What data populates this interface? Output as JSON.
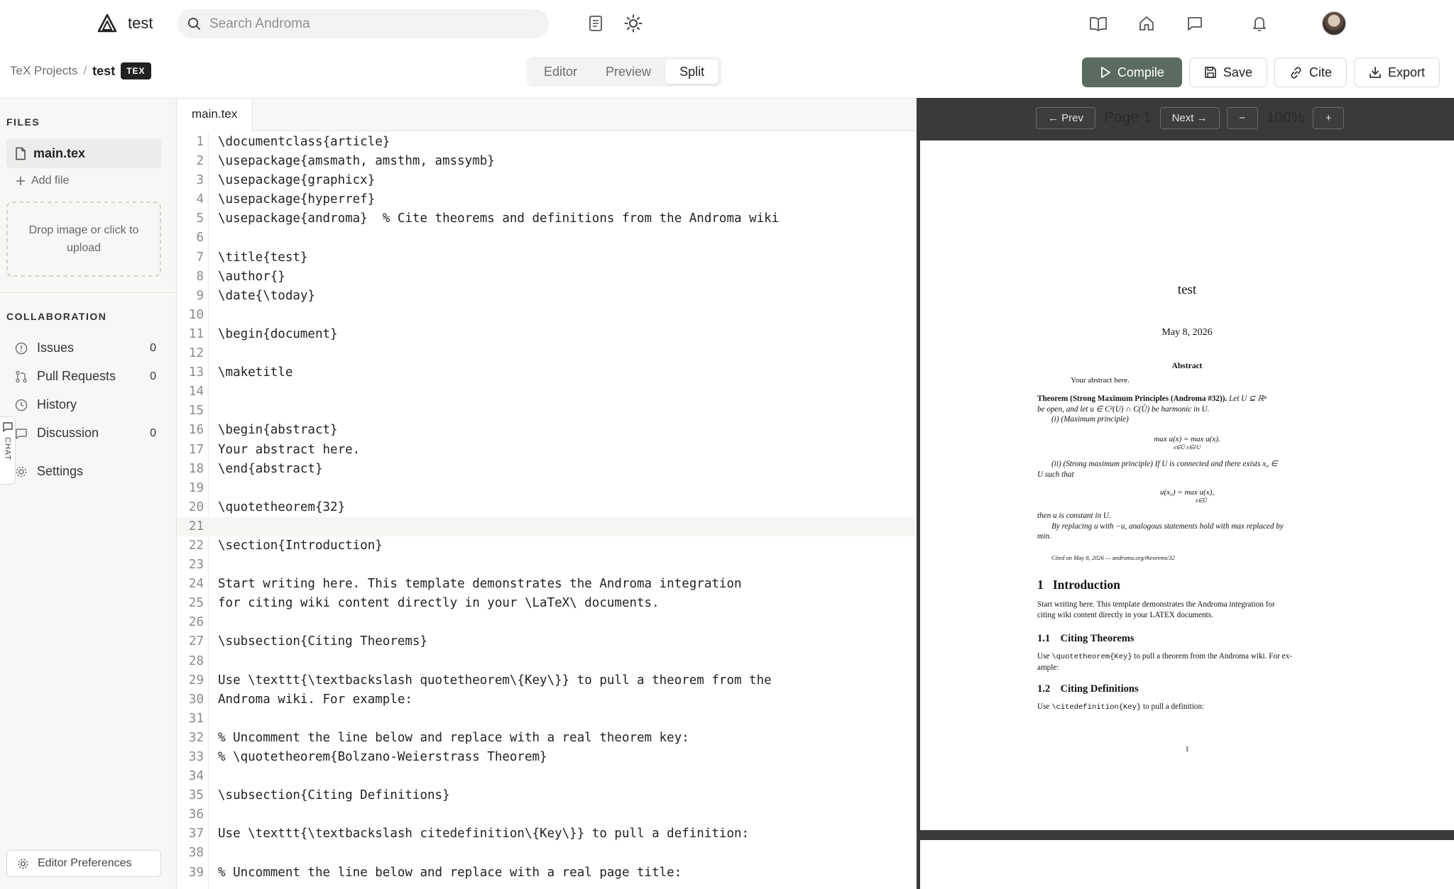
{
  "app": {
    "title": "test"
  },
  "search": {
    "placeholder": "Search Androma"
  },
  "breadcrumb": {
    "root": "TeX Projects",
    "separator": "/",
    "current": "test",
    "badge": "TEX"
  },
  "view_modes": [
    {
      "label": "Editor",
      "active": false
    },
    {
      "label": "Preview",
      "active": false
    },
    {
      "label": "Split",
      "active": true
    }
  ],
  "actions": {
    "compile": "Compile",
    "save": "Save",
    "cite": "Cite",
    "export": "Export"
  },
  "sidebar": {
    "files_title": "FILES",
    "files": [
      {
        "name": "main.tex"
      }
    ],
    "add_file": "Add file",
    "dropzone": "Drop image or click to upload",
    "collab_title": "COLLABORATION",
    "collab_items": [
      {
        "label": "Issues",
        "count": "0",
        "icon": "issue-icon"
      },
      {
        "label": "Pull Requests",
        "count": "0",
        "icon": "pull-request-icon"
      },
      {
        "label": "History",
        "count": "",
        "icon": "history-icon"
      },
      {
        "label": "Discussion",
        "count": "0",
        "icon": "discussion-icon"
      },
      {
        "label": "Settings",
        "count": "",
        "icon": "gear-icon"
      }
    ],
    "chat_tab": "CHAT",
    "editor_preferences": "Editor Preferences"
  },
  "editor": {
    "tab": "main.tex",
    "current_line": 21,
    "lines": [
      "\\documentclass{article}",
      "\\usepackage{amsmath, amsthm, amssymb}",
      "\\usepackage{graphicx}",
      "\\usepackage{hyperref}",
      "\\usepackage{androma}  % Cite theorems and definitions from the Androma wiki",
      "",
      "\\title{test}",
      "\\author{}",
      "\\date{\\today}",
      "",
      "\\begin{document}",
      "",
      "\\maketitle",
      "",
      "",
      "\\begin{abstract}",
      "Your abstract here.",
      "\\end{abstract}",
      "",
      "\\quotetheorem{32}",
      "",
      "\\section{Introduction}",
      "",
      "Start writing here. This template demonstrates the Androma integration",
      "for citing wiki content directly in your \\LaTeX\\ documents.",
      "",
      "\\subsection{Citing Theorems}",
      "",
      "Use \\texttt{\\textbackslash quotetheorem\\{Key\\}} to pull a theorem from the",
      "Androma wiki. For example:",
      "",
      "% Uncomment the line below and replace with a real theorem key:",
      "% \\quotetheorem{Bolzano-Weierstrass Theorem}",
      "",
      "\\subsection{Citing Definitions}",
      "",
      "Use \\texttt{\\textbackslash citedefinition\\{Key\\}} to pull a definition:",
      "",
      "% Uncomment the line below and replace with a real page title:"
    ]
  },
  "preview": {
    "prev": "← Prev",
    "page_label": "Page 1",
    "next": "Next →",
    "zoom_out": "−",
    "zoom": "100%",
    "zoom_in": "+",
    "doc": {
      "title": "test",
      "date": "May 8, 2026",
      "abstract_heading": "Abstract",
      "abstract": "Your abstract here.",
      "theorem_head": "Theorem (Strong Maximum Principles (Androma #32)).",
      "theorem_line1": "Let U ⊆ ℝⁿ",
      "theorem_line2": "be open, and let u ∈ C²(U) ∩ C(Ū) be harmonic in U.",
      "item1": "(i) (Maximum principle)",
      "eq1": "max u(x) = max u(x).",
      "eq1_sub": "x∈Ū          x∈∂U",
      "item2_line1": "(ii) (Strong maximum principle) If U is connected and there exists x₀ ∈",
      "item2_line2": "U such that",
      "eq2": "u(x₀) = max u(x),",
      "eq2_sub": "x∈Ū",
      "constant": "then u is constant in U.",
      "replace_line1": "By replacing u with −u, analogous statements hold with max replaced by",
      "replace_line2": "min.",
      "cited": "Cited on May 8, 2026 — androma.org/theorems/32",
      "sec1_num": "1",
      "sec1": "Introduction",
      "intro_line1": "Start writing here.  This template demonstrates the Androma integration for",
      "intro_line2": "citing wiki content directly in your LATEX documents.",
      "sub1_num": "1.1",
      "sub1": "Citing Theorems",
      "sub1_line1_a": "Use ",
      "sub1_line1_code": "\\quotetheorem{Key}",
      "sub1_line1_b": " to pull a theorem from the Androma wiki.  For ex-",
      "sub1_line2": "ample:",
      "sub2_num": "1.2",
      "sub2": "Citing Definitions",
      "sub2_line_a": "Use ",
      "sub2_line_code": "\\citedefinition{Key}",
      "sub2_line_b": " to pull a definition:",
      "page_number": "1"
    }
  }
}
